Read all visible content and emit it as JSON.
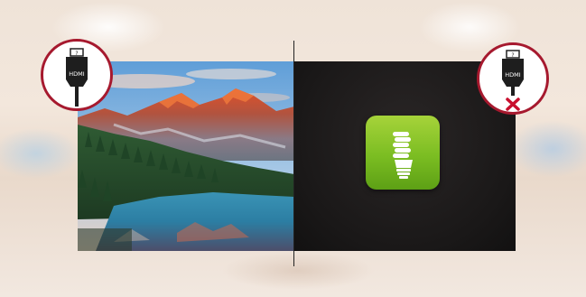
{
  "left_connector": {
    "label": "HDMI",
    "status": "connected"
  },
  "right_connector": {
    "label": "HDMI",
    "status": "disconnected"
  },
  "colors": {
    "badge_border": "#a6192e",
    "eco_green": "#7bbd22",
    "disconnect_x": "#c8102e"
  },
  "icons": {
    "left_badge": "hdmi-connected-icon",
    "right_badge": "hdmi-disconnected-icon",
    "screen_center": "energy-saving-bulb-icon"
  }
}
